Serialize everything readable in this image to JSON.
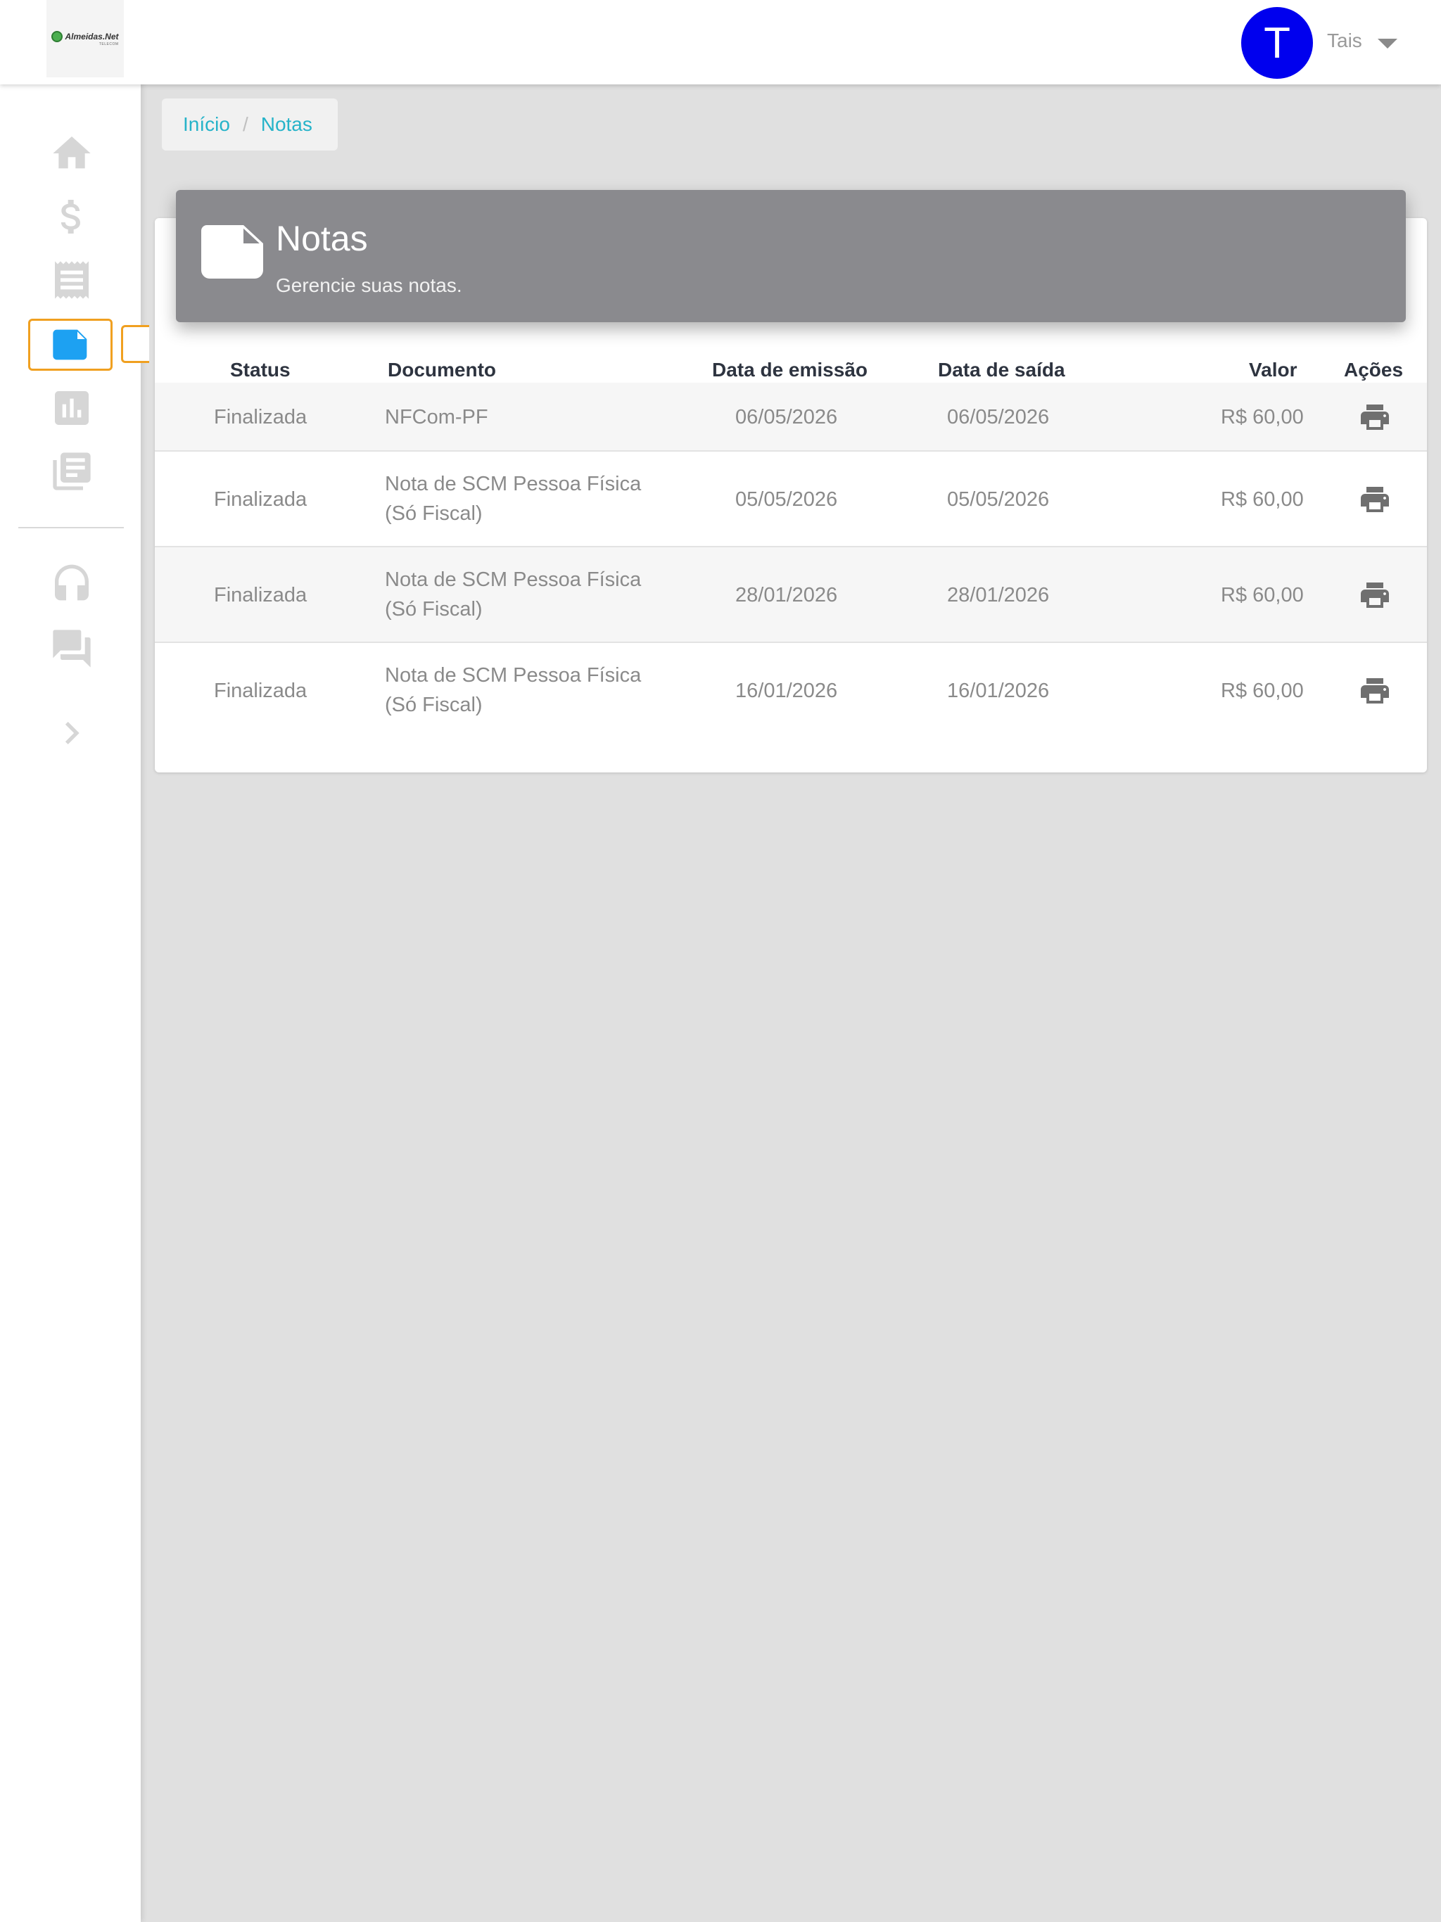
{
  "brand": {
    "logo_text": "Almeidas.Net",
    "logo_sub": "TELECOM"
  },
  "user": {
    "initial": "T",
    "name": "Tais"
  },
  "breadcrumb": {
    "home": "Início",
    "separator": "/",
    "current": "Notas"
  },
  "page": {
    "title": "Notas",
    "subtitle": "Gerencie suas notas."
  },
  "table": {
    "headers": {
      "status": "Status",
      "documento": "Documento",
      "emissao": "Data de emissão",
      "saida": "Data de saída",
      "valor": "Valor",
      "acoes": "Ações"
    },
    "rows": [
      {
        "status": "Finalizada",
        "doc1": "NFCom-PF",
        "doc2": "",
        "emissao": "06/05/2026",
        "saida": "06/05/2026",
        "valor": "R$ 60,00"
      },
      {
        "status": "Finalizada",
        "doc1": "Nota de SCM Pessoa Física",
        "doc2": "(Só Fiscal)",
        "emissao": "05/05/2026",
        "saida": "05/05/2026",
        "valor": "R$ 60,00"
      },
      {
        "status": "Finalizada",
        "doc1": "Nota de SCM Pessoa Física",
        "doc2": "(Só Fiscal)",
        "emissao": "28/01/2026",
        "saida": "28/01/2026",
        "valor": "R$ 60,00"
      },
      {
        "status": "Finalizada",
        "doc1": "Nota de SCM Pessoa Física",
        "doc2": "(Só Fiscal)",
        "emissao": "16/01/2026",
        "saida": "16/01/2026",
        "valor": "R$ 60,00"
      }
    ]
  },
  "colors": {
    "accent": "#26b3c9",
    "active_icon": "#1da1f2",
    "highlight": "#f0a020",
    "avatar": "#0000ee",
    "header_bg": "#8a8a8e"
  },
  "icons": [
    "home-icon",
    "dollar-icon",
    "receipt-icon",
    "note-icon",
    "chart-icon",
    "library-icon",
    "headset-icon",
    "chat-icon",
    "chevron-right-icon",
    "print-icon",
    "caret-down-icon"
  ]
}
